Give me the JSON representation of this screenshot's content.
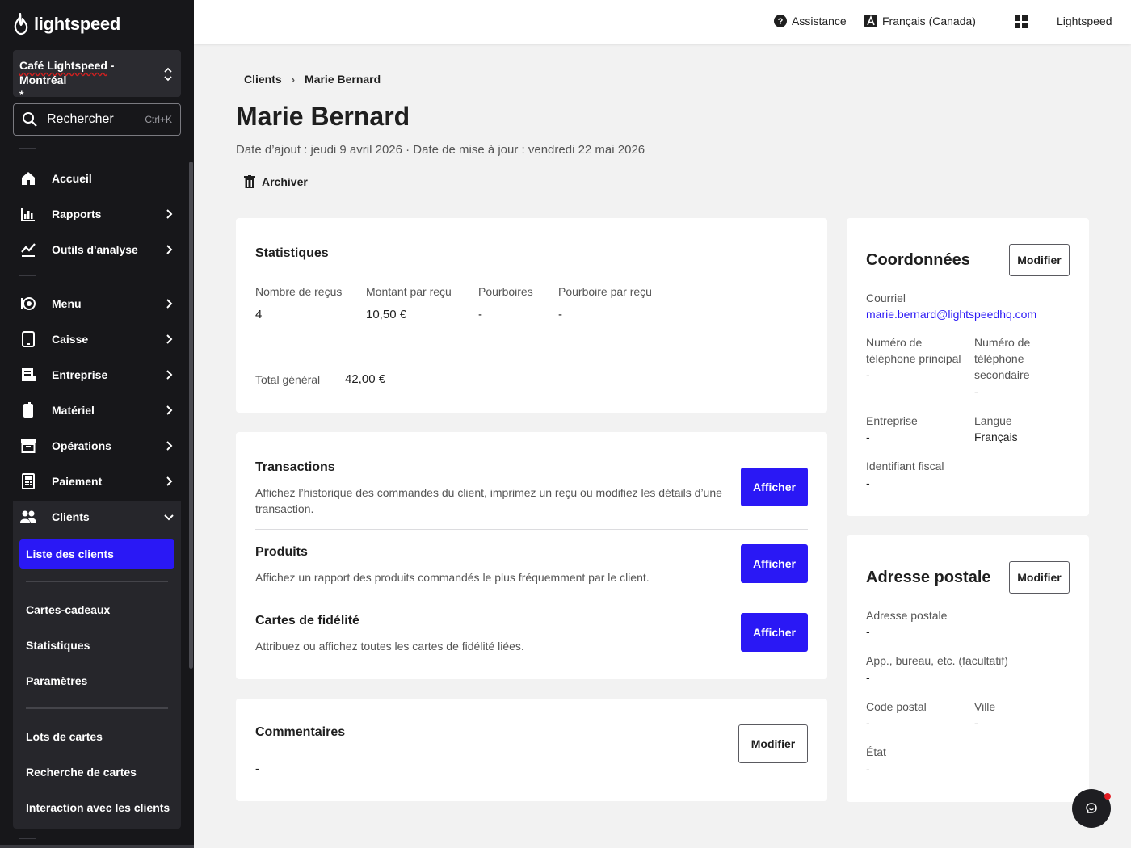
{
  "sidebar": {
    "logo_text": "lightspeed",
    "store_name_a": "Café Lightspeed",
    "store_name_b": " - Montréal",
    "store_name_c": "*",
    "search_label": "Rechercher",
    "search_shortcut": "Ctrl+K",
    "nav": [
      {
        "label": "Accueil",
        "icon": "home-icon"
      },
      {
        "label": "Rapports",
        "icon": "bar-chart-icon"
      },
      {
        "label": "Outils d'analyse",
        "icon": "trend-icon"
      },
      {
        "label": "Menu",
        "icon": "menu-dish-icon"
      },
      {
        "label": "Caisse",
        "icon": "tablet-icon"
      },
      {
        "label": "Entreprise",
        "icon": "building-icon"
      },
      {
        "label": "Matériel",
        "icon": "device-icon"
      },
      {
        "label": "Opérations",
        "icon": "archive-box-icon"
      },
      {
        "label": "Paiement",
        "icon": "payment-terminal-icon"
      },
      {
        "label": "Clients",
        "icon": "users-icon"
      }
    ],
    "clients_sub": {
      "active": "Liste des clients",
      "items": [
        "Cartes-cadeaux",
        "Statistiques",
        "Paramètres",
        "Lots de cartes",
        "Recherche de cartes",
        "Interaction avec les clients"
      ]
    }
  },
  "topbar": {
    "help": "Assistance",
    "language": "Français (Canada)",
    "account": "Lightspeed"
  },
  "breadcrumb": {
    "parent": "Clients",
    "current": "Marie Bernard"
  },
  "page": {
    "title": "Marie Bernard",
    "subtitle": "Date d’ajout : jeudi 9 avril 2026 · Date de mise à jour : vendredi 22 mai 2026",
    "archive_label": "Archiver"
  },
  "stats": {
    "title": "Statistiques",
    "columns": [
      {
        "label": "Nombre de reçus",
        "value": "4"
      },
      {
        "label": "Montant par reçu",
        "value": "10,50 €"
      },
      {
        "label": "Pourboires",
        "value": "-"
      },
      {
        "label": "Pourboire par reçu",
        "value": "-"
      }
    ],
    "total_label": "Total général",
    "total_value": "42,00 €"
  },
  "sections": [
    {
      "title": "Transactions",
      "desc": "Affichez l’historique des commandes du client, imprimez un reçu ou modifiez les détails d’une transaction.",
      "button": "Afficher"
    },
    {
      "title": "Produits",
      "desc": "Affichez un rapport des produits commandés le plus fréquemment par le client.",
      "button": "Afficher"
    },
    {
      "title": "Cartes de fidélité",
      "desc": "Attribuez ou affichez toutes les cartes de fidélité liées.",
      "button": "Afficher"
    }
  ],
  "comments": {
    "title": "Commentaires",
    "value": "-",
    "button": "Modifier"
  },
  "contact": {
    "title": "Coordonnées",
    "button": "Modifier",
    "email_label": "Courriel",
    "email": "marie.bernard@lightspeedhq.com",
    "phone_main_label": "Numéro de téléphone principal",
    "phone_main": "-",
    "phone_secondary_label": "Numéro de téléphone secondaire",
    "phone_secondary": "-",
    "company_label": "Entreprise",
    "company": "-",
    "language_label": "Langue",
    "language": "Français",
    "tax_id_label": "Identifiant fiscal",
    "tax_id": "-"
  },
  "address": {
    "title": "Adresse postale",
    "button": "Modifier",
    "street_label": "Adresse postale",
    "street": "-",
    "unit_label": "App., bureau, etc. (facultatif)",
    "unit": "-",
    "postal_label": "Code postal",
    "postal": "-",
    "city_label": "Ville",
    "city": "-",
    "state_label": "État",
    "state": "-"
  },
  "colors": {
    "accent": "#2a18f5",
    "sidebar_bg": "#17171a",
    "page_bg": "#f2f2f2"
  }
}
